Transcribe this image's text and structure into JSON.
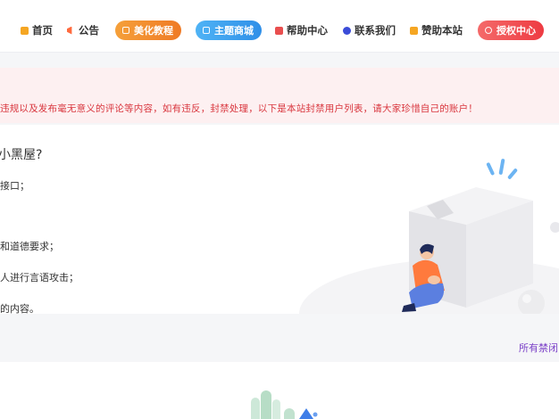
{
  "nav": {
    "items": [
      {
        "label": "首页",
        "icon": "home-icon",
        "color": "#f5a623"
      },
      {
        "label": "公告",
        "icon": "megaphone-icon",
        "color": "#ff6a3d"
      },
      {
        "label": "帮助中心",
        "icon": "help-icon",
        "color": "#e94f4f"
      },
      {
        "label": "联系我们",
        "icon": "contact-icon",
        "color": "#3b4cd8"
      },
      {
        "label": "赞助本站",
        "icon": "gift-icon",
        "color": "#f5a623"
      }
    ],
    "pills": [
      {
        "label": "美化教程",
        "icon": "brush-icon",
        "color": "#f08b2c"
      },
      {
        "label": "主题商城",
        "icon": "shop-icon",
        "color": "#3aa1ef"
      },
      {
        "label": "授权中心",
        "icon": "shield-icon",
        "color": "#f0484d"
      }
    ]
  },
  "notice": {
    "text": "违规以及发布毫无意义的评论等内容，如有违反，封禁处理，以下是本站封禁用户列表，请大家珍惜自己的账户！"
  },
  "main": {
    "title": "小黑屋?",
    "rules": [
      "接口；",
      "和道德要求；",
      "人进行言语攻击；",
      "的内容。"
    ]
  },
  "footer": {
    "all_banned_label": "所有禁闭"
  }
}
